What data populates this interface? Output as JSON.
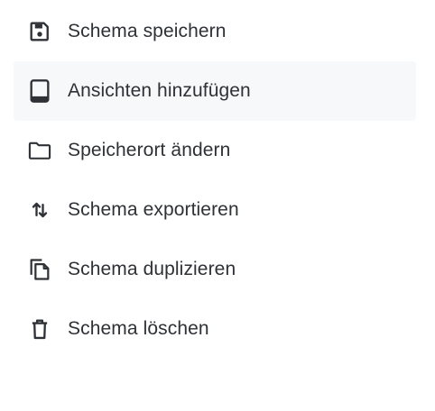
{
  "menu": {
    "items": [
      {
        "label": "Schema speichern",
        "icon": "save-icon"
      },
      {
        "label": "Ansichten hinzufügen",
        "icon": "tablet-icon",
        "highlighted": true
      },
      {
        "label": "Speicherort ändern",
        "icon": "folder-icon"
      },
      {
        "label": "Schema exportieren",
        "icon": "swap-vertical-icon"
      },
      {
        "label": "Schema duplizieren",
        "icon": "copy-icon"
      },
      {
        "label": "Schema löschen",
        "icon": "trash-icon"
      }
    ]
  },
  "colors": {
    "text": "#2e3136",
    "icon": "#2e3136",
    "highlight_background": "#f7f8fa"
  }
}
